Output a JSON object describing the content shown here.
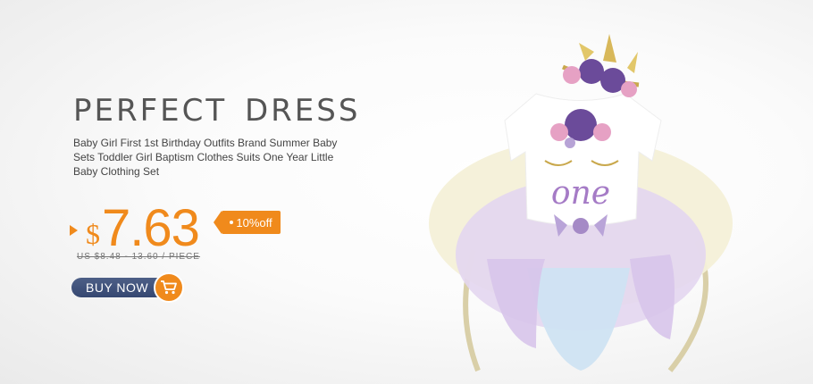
{
  "banner": {
    "headline": "PERFECT DRESS",
    "description": "Baby Girl First 1st Birthday Outfits Brand Summer Baby Sets Toddler Girl Baptism Clothes Suits One Year Little Baby Clothing Set",
    "currency_symbol": "$",
    "price": "7.63",
    "discount": "10%off",
    "original_range": "US $8.48 - 13.60 / PIECE",
    "buy_button": "BUY NOW",
    "shirt_text": "one"
  },
  "colors": {
    "accent": "#f08a1c",
    "button": "#3d4f7a",
    "text": "#555555"
  },
  "icons": [
    "arrow-right-icon",
    "cart-icon"
  ]
}
